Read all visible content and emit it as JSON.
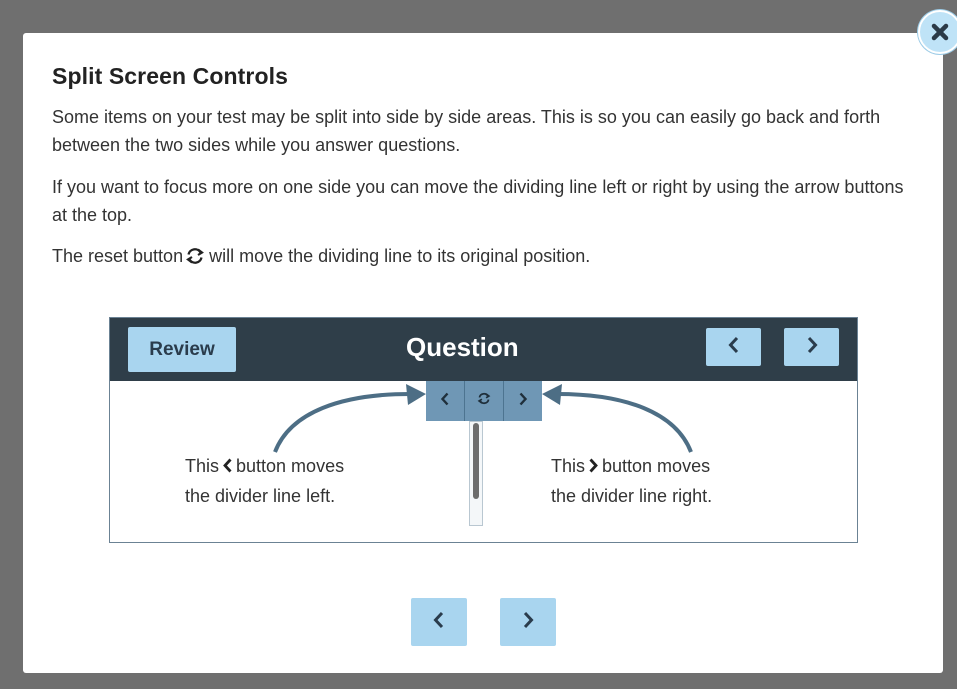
{
  "dialog": {
    "title": "Split Screen Controls",
    "paragraph1": "Some items on your test may be split into side by side areas. This is so you can easily go back and forth between the two sides while you answer questions.",
    "paragraph2": "If you want to focus more on one side you can move the dividing line left or right by using the arrow buttons at the top.",
    "paragraph3_before": "The reset button",
    "paragraph3_after": "will move the dividing line to its original position."
  },
  "illustration": {
    "review_label": "Review",
    "question_label": "Question",
    "left_callout": {
      "line1_before": "This",
      "line1_after": "button moves",
      "line2": "the divider line left."
    },
    "right_callout": {
      "line1_before": "This",
      "line1_after": "button moves",
      "line2": "the divider line right."
    }
  },
  "icons": {
    "close": "close-icon",
    "reset": "refresh-icon",
    "prev": "chevron-left-icon",
    "next": "chevron-right-icon"
  },
  "colors": {
    "accent_button": "#a9d5ef",
    "header_dark": "#2f3e49",
    "split_control": "#6f97b5",
    "overlay": "#6f6f6f"
  }
}
